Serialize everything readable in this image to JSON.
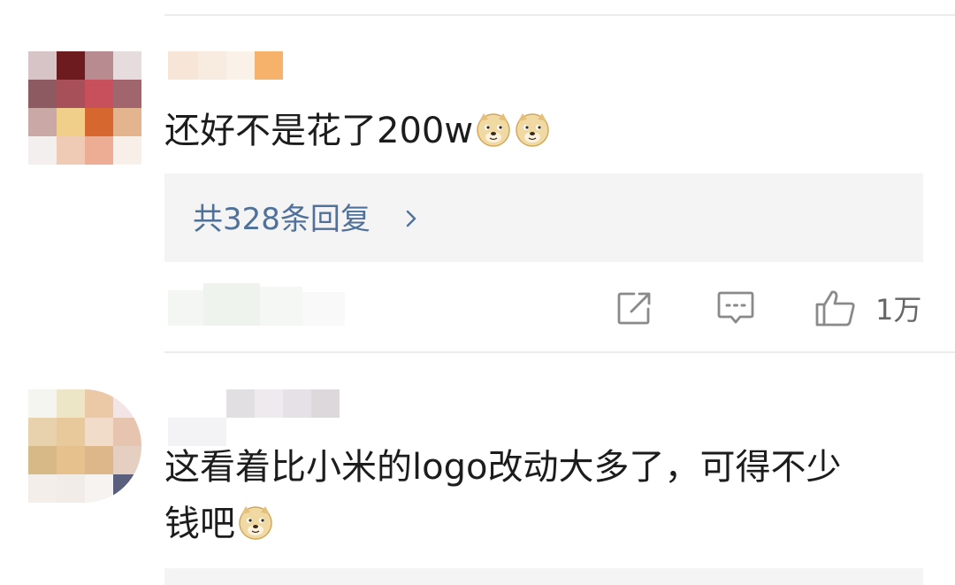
{
  "comments": [
    {
      "text": "还好不是花了200w",
      "emoji": [
        "doge-emoji",
        "doge-emoji"
      ],
      "replies_label": "共328条回复",
      "actions": {
        "like_count": "1万"
      }
    },
    {
      "text_line1": "这看着比小米的logo改动大多了，可得不少",
      "text_line2": "钱吧",
      "emoji": [
        "doge-emoji"
      ]
    }
  ],
  "icons": {
    "share": "share-icon",
    "reply": "comment-icon",
    "like": "thumbs-up-icon",
    "chevron": "chevron-right-icon"
  },
  "colors": {
    "link": "#50719a",
    "icon_gray": "#8a8a8a",
    "reply_bg": "#f4f4f4",
    "divider": "#ececec"
  }
}
